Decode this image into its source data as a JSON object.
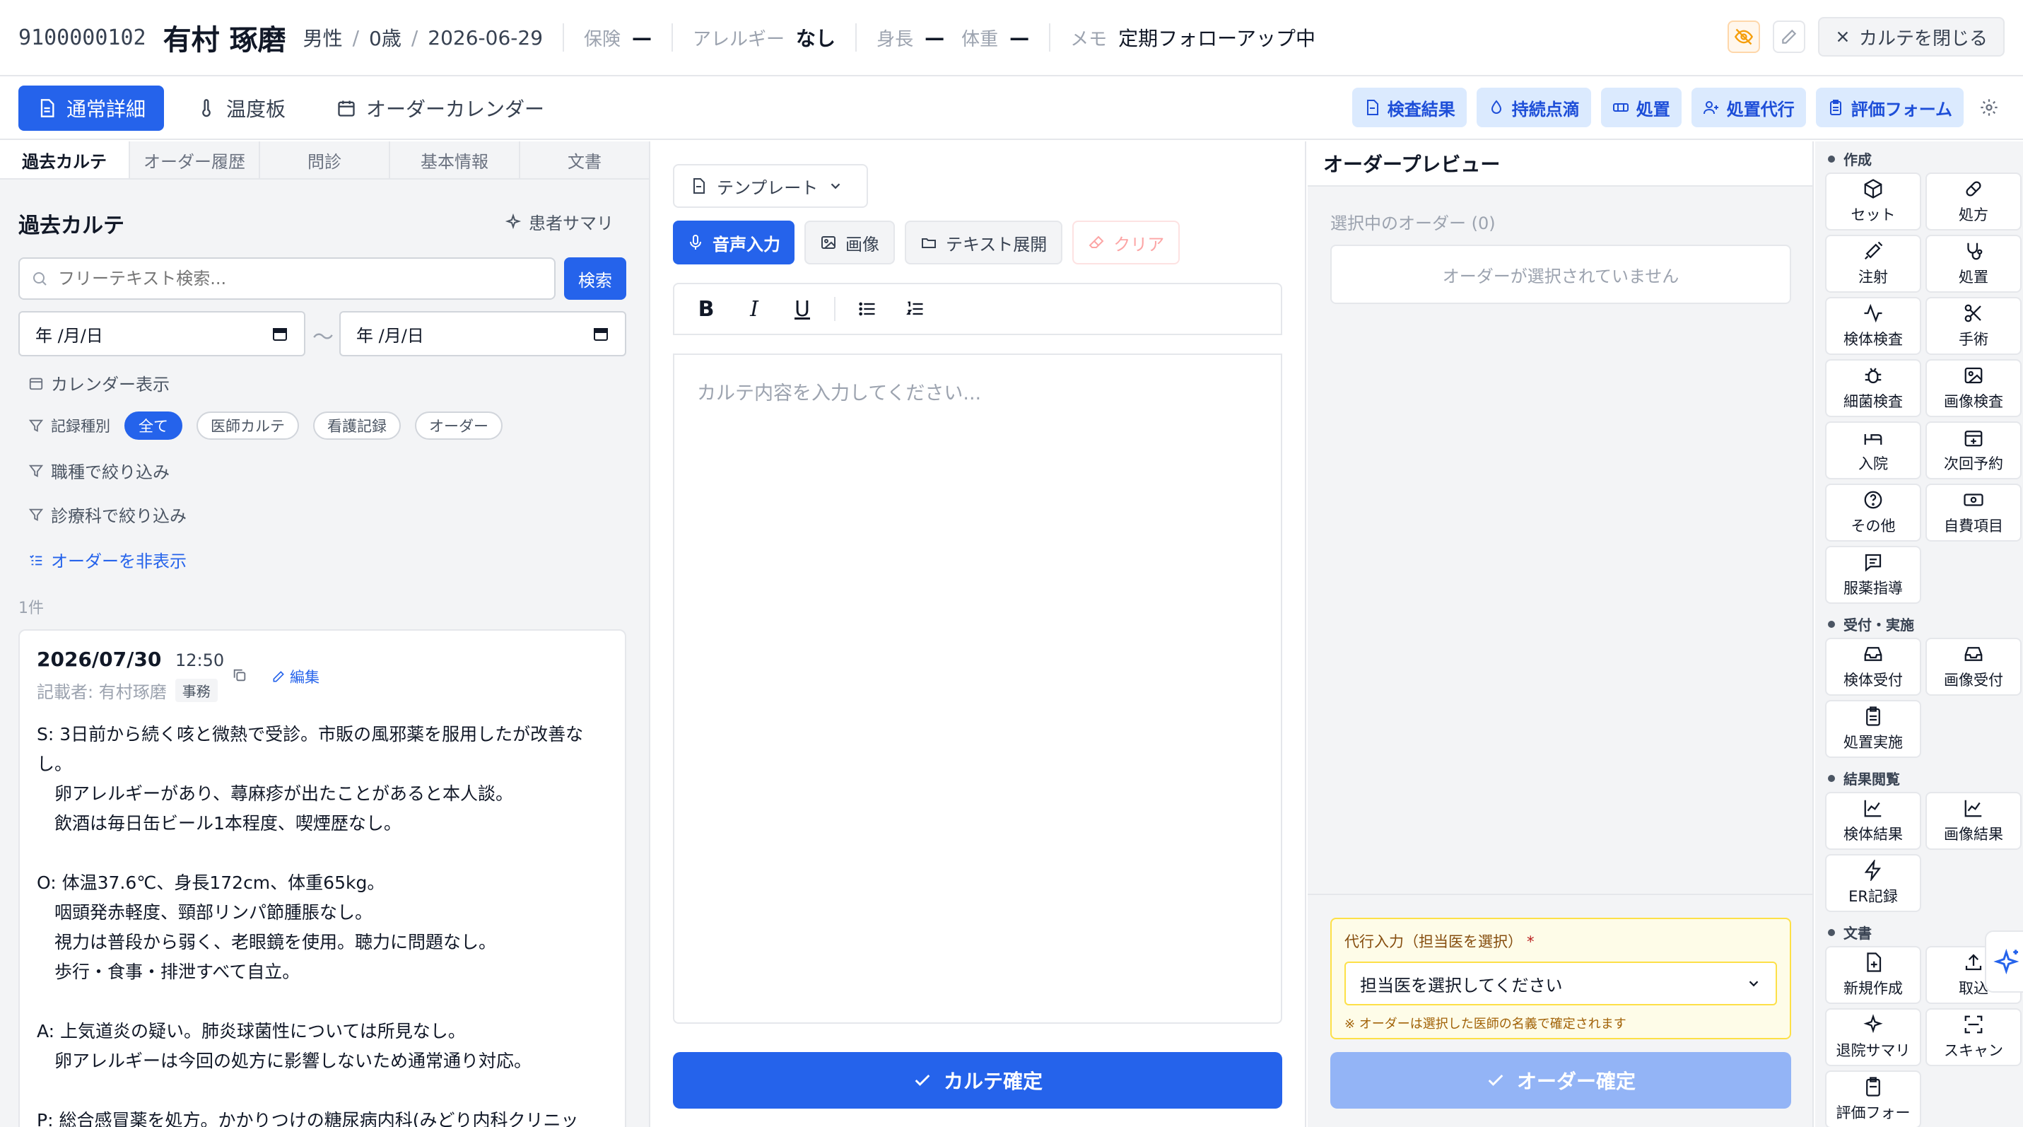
{
  "header": {
    "patient_id": "9100000102",
    "patient_name": "有村 琢磨",
    "sex": "男性",
    "age": "0歳",
    "date": "2026-06-29",
    "sep": "/",
    "insurance_label": "保険",
    "insurance_value": "—",
    "allergy_label": "アレルギー",
    "allergy_value": "なし",
    "height_label": "身長",
    "height_value": "—",
    "weight_label": "体重",
    "weight_value": "—",
    "memo_label": "メモ",
    "memo_value": "定期フォローアップ中",
    "close_label": "カルテを閉じる"
  },
  "main_tabs": [
    {
      "label": "通常詳細",
      "icon": "document-icon"
    },
    {
      "label": "温度板",
      "icon": "thermometer-icon"
    },
    {
      "label": "オーダーカレンダー",
      "icon": "calendar-icon"
    }
  ],
  "tools": [
    {
      "label": "検査結果",
      "icon": "document-icon"
    },
    {
      "label": "持続点滴",
      "icon": "droplet-icon"
    },
    {
      "label": "処置",
      "icon": "bandage-icon"
    },
    {
      "label": "処置代行",
      "icon": "user-proxy-icon"
    },
    {
      "label": "評価フォーム",
      "icon": "clipboard-icon"
    }
  ],
  "left": {
    "subtabs": [
      "過去カルテ",
      "オーダー履歴",
      "問診",
      "基本情報",
      "文書"
    ],
    "title": "過去カルテ",
    "patient_summary": "患者サマリ",
    "search_placeholder": "フリーテキスト検索...",
    "search_button": "検索",
    "date_placeholder": "年 /月/日",
    "tilde": "〜",
    "calendar_toggle": "カレンダー表示",
    "record_type_label": "記録種別",
    "record_type_chips": [
      "全て",
      "医師カルテ",
      "看護記録",
      "オーダー"
    ],
    "occupation_filter": "職種で絞り込み",
    "department_filter": "診療科で絞り込み",
    "hide_orders": "オーダーを非表示",
    "count": "1件",
    "record": {
      "date": "2026/07/30",
      "time": "12:50",
      "edit": "編集",
      "author": "記載者: 有村琢磨",
      "role": "事務",
      "body": "S: 3日前から続く咳と微熱で受診。市販の風邪薬を服用したが改善なし。\n　卵アレルギーがあり、蕁麻疹が出たことがあると本人談。\n　飲酒は毎日缶ビール1本程度、喫煙歴なし。\n\nO: 体温37.6℃、身長172cm、体重65kg。\n　咽頭発赤軽度、頸部リンパ節腫脹なし。\n　視力は普段から弱く、老眼鏡を使用。聴力に問題なし。\n　歩行・食事・排泄すべて自立。\n\nA: 上気道炎の疑い。肺炎球菌性については所見なし。\n　卵アレルギーは今回の処方に影響しないため通常通り対応。\n\nP: 総合感冒薬を処方。かかりつけの糖尿病内科(みどり内科クリニッ"
    }
  },
  "middle": {
    "template_label": "テンプレート",
    "voice_input": "音声入力",
    "image": "画像",
    "text_expand": "テキスト展開",
    "clear": "クリア",
    "format": {
      "bold": "B",
      "italic": "I",
      "underline": "U"
    },
    "editor_placeholder": "カルテ内容を入力してください...",
    "confirm": "カルテ確定"
  },
  "order": {
    "title": "オーダープレビュー",
    "selected_label": "選択中のオーダー (0)",
    "empty": "オーダーが選択されていません",
    "proxy_label": "代行入力（担当医を選択）",
    "required_mark": "*",
    "proxy_placeholder": "担当医を選択してください",
    "proxy_note": "※ オーダーは選択した医師の名義で確定されます",
    "confirm": "オーダー確定"
  },
  "sidebar": {
    "sections": [
      {
        "title": "作成",
        "items": [
          {
            "label": "セット",
            "icon": "package-icon"
          },
          {
            "label": "処方",
            "icon": "pill-icon"
          },
          {
            "label": "注射",
            "icon": "syringe-icon"
          },
          {
            "label": "処置",
            "icon": "stethoscope-icon"
          },
          {
            "label": "検体検査",
            "icon": "activity-icon"
          },
          {
            "label": "手術",
            "icon": "scissors-icon"
          },
          {
            "label": "細菌検査",
            "icon": "bug-icon"
          },
          {
            "label": "画像検査",
            "icon": "image-icon"
          },
          {
            "label": "入院",
            "icon": "bed-icon"
          },
          {
            "label": "次回予約",
            "icon": "calendar-plus-icon"
          },
          {
            "label": "その他",
            "icon": "help-circle-icon"
          },
          {
            "label": "自費項目",
            "icon": "cash-icon"
          },
          {
            "label": "服薬指導",
            "icon": "message-icon"
          }
        ]
      },
      {
        "title": "受付・実施",
        "items": [
          {
            "label": "検体受付",
            "icon": "inbox-icon"
          },
          {
            "label": "画像受付",
            "icon": "inbox-icon"
          },
          {
            "label": "処置実施",
            "icon": "clipboard-icon"
          }
        ]
      },
      {
        "title": "結果閲覧",
        "items": [
          {
            "label": "検体結果",
            "icon": "chart-line-icon"
          },
          {
            "label": "画像結果",
            "icon": "chart-line-icon"
          },
          {
            "label": "ER記録",
            "icon": "bolt-icon"
          }
        ]
      },
      {
        "title": "文書",
        "items": [
          {
            "label": "新規作成",
            "icon": "file-plus-icon"
          },
          {
            "label": "取込",
            "icon": "upload-icon"
          },
          {
            "label": "退院サマリ",
            "icon": "sparkle-icon"
          },
          {
            "label": "スキャン",
            "icon": "scan-icon"
          },
          {
            "label": "評価フォー",
            "icon": "clipboard-icon"
          }
        ]
      }
    ]
  },
  "colors": {
    "primary": "#2563eb",
    "primary_light": "#dbeafe",
    "disabled_primary": "#93b4f6",
    "warning_bg": "#fefce8",
    "warning_border": "#fde047"
  }
}
